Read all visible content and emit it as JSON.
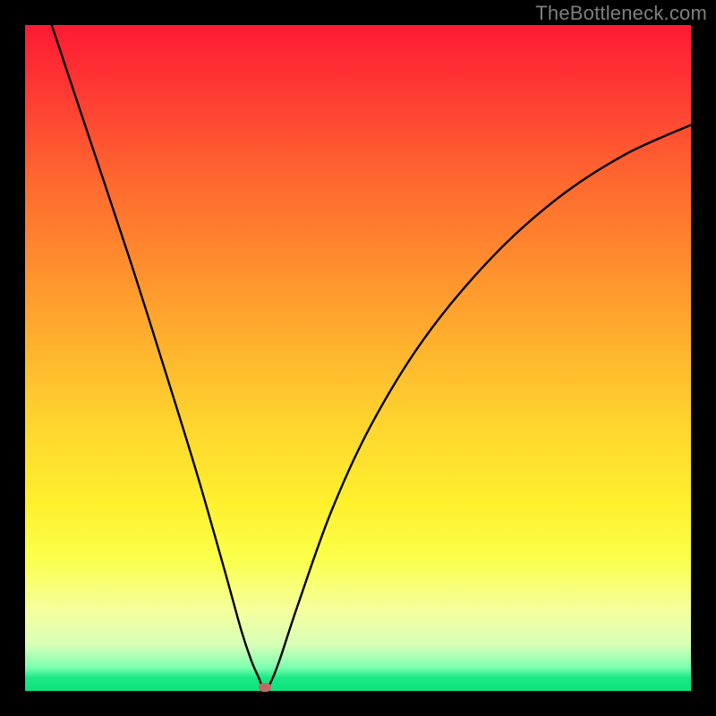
{
  "watermark": "TheBottleneck.com",
  "chart_data": {
    "type": "line",
    "title": "",
    "xlabel": "",
    "ylabel": "",
    "xlim": [
      0,
      100
    ],
    "ylim": [
      0,
      100
    ],
    "grid": false,
    "series": [
      {
        "name": "curve",
        "x": [
          4,
          10,
          16,
          22,
          26,
          30,
          32.5,
          34,
          35,
          35.7,
          36.5,
          38,
          41,
          46,
          52,
          60,
          70,
          80,
          90,
          100
        ],
        "y": [
          100,
          82,
          64,
          45,
          32,
          18,
          9,
          4.5,
          2.2,
          0.6,
          0.6,
          4,
          13,
          27,
          40,
          53,
          65,
          74,
          80.5,
          85
        ]
      }
    ],
    "marker": {
      "x": 36,
      "y": 0.5,
      "color": "#c26868"
    },
    "gradient_stops": [
      {
        "pos": 0,
        "color": "#ff1a33"
      },
      {
        "pos": 0.5,
        "color": "#ffc22e"
      },
      {
        "pos": 0.8,
        "color": "#fbff4a"
      },
      {
        "pos": 1.0,
        "color": "#0de37a"
      }
    ]
  }
}
